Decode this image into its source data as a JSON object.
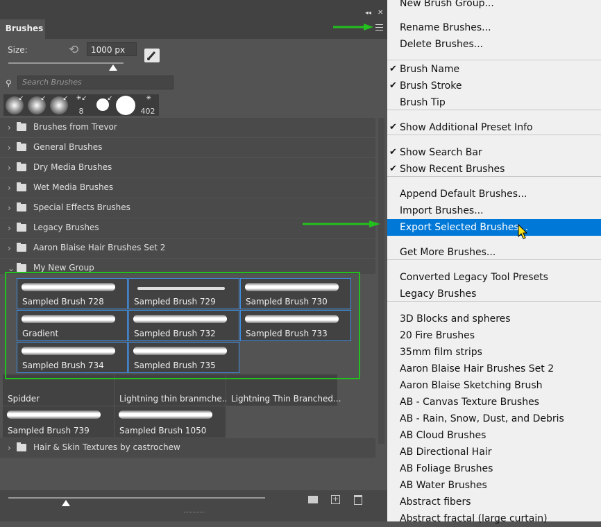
{
  "panel": {
    "tab_label": "Brushes",
    "size_label": "Size:",
    "size_value": "1000 px",
    "size_slider_fraction": 0.9,
    "search_placeholder": "Search Brushes",
    "recent_brushes": [
      {
        "num": ""
      },
      {
        "num": ""
      },
      {
        "num": ""
      },
      {
        "num": "8"
      },
      {
        "num": ""
      },
      {
        "num": ""
      },
      {
        "num": "402"
      }
    ],
    "groups": [
      "Brushes from Trevor",
      "General Brushes",
      "Dry Media Brushes",
      "Wet Media Brushes",
      "Special Effects Brushes",
      "Legacy Brushes",
      "Aaron Blaise Hair Brushes Set 2",
      "My New Group"
    ],
    "selected_brushes": [
      "Sampled Brush 728",
      "Sampled Brush 729",
      "Sampled Brush 730",
      "Gradient",
      "Sampled Brush 732",
      "Sampled Brush 733",
      "Sampled Brush 734",
      "Sampled Brush 735"
    ],
    "other_brushes": [
      "Spidder",
      "Lightning thin branmche...",
      "Lightning Thin Branched...",
      "Sampled Brush 739",
      "Sampled Brush 1050"
    ],
    "last_group": "Hair & Skin Textures by castrochew"
  },
  "menu": {
    "top_partial": "New Brush Group...",
    "items": [
      {
        "label": "Rename Brushes...",
        "checked": false
      },
      {
        "label": "Delete Brushes...",
        "checked": false
      },
      {
        "label": "Brush Name",
        "checked": true
      },
      {
        "label": "Brush Stroke",
        "checked": true
      },
      {
        "label": "Brush Tip",
        "checked": false
      },
      {
        "label": "Show Additional Preset Info",
        "checked": true
      },
      {
        "label": "Show Search Bar",
        "checked": true
      },
      {
        "label": "Show Recent Brushes",
        "checked": true
      },
      {
        "label": "Append Default Brushes...",
        "checked": false
      },
      {
        "label": "Import Brushes...",
        "checked": false
      },
      {
        "label": "Export Selected Brushes...",
        "checked": false,
        "highlighted": true
      },
      {
        "label": "Get More Brushes...",
        "checked": false
      },
      {
        "label": "Converted Legacy Tool Presets",
        "checked": false
      },
      {
        "label": "Legacy Brushes",
        "checked": false
      },
      {
        "label": "3D Blocks and spheres",
        "checked": false
      },
      {
        "label": "20 Fire Brushes",
        "checked": false
      },
      {
        "label": "35mm film strips",
        "checked": false
      },
      {
        "label": "Aaron Blaise Hair Brushes Set 2",
        "checked": false
      },
      {
        "label": "Aaron Blaise Sketching Brush",
        "checked": false
      },
      {
        "label": "AB - Canvas Texture Brushes",
        "checked": false
      },
      {
        "label": "AB - Rain, Snow, Dust, and Debris",
        "checked": false
      },
      {
        "label": "AB Cloud Brushes",
        "checked": false
      },
      {
        "label": "AB Directional Hair",
        "checked": false
      },
      {
        "label": "AB Foliage Brushes",
        "checked": false
      },
      {
        "label": "AB Water Brushes",
        "checked": false
      },
      {
        "label": "Abstract fibers",
        "checked": false
      },
      {
        "label": "Abstract fractal (large curtain)",
        "checked": false
      }
    ],
    "check_mark": "✔",
    "accent": "#0078d7",
    "annotation_color": "#23c11e"
  }
}
